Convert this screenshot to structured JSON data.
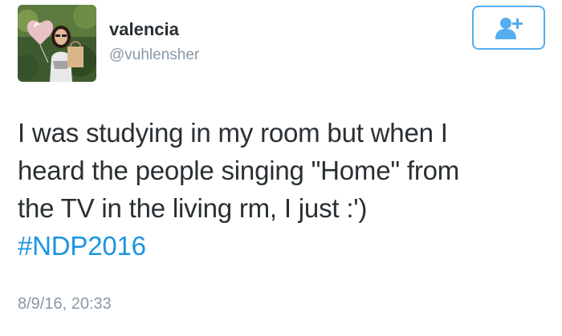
{
  "author": {
    "display_name": "valencia",
    "handle": "@vuhlensher",
    "avatar_icon": "profile-photo"
  },
  "follow_button": {
    "icon": "add-user-icon",
    "accent_color": "#55acee"
  },
  "tweet": {
    "lines": [
      "I was studying in my room but when I",
      "heard the people singing \"Home\" from",
      "the TV in the living rm, I just :')"
    ],
    "hashtag": "#NDP2016",
    "hashtag_color": "#1b95e0",
    "timestamp": "8/9/16, 20:33"
  }
}
